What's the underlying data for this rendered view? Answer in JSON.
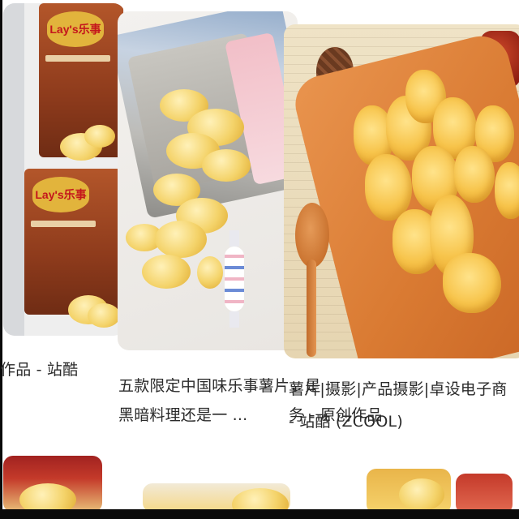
{
  "results": [
    {
      "caption": "作品 - 站酷",
      "image": {
        "brand_logo": "Lay's乐事",
        "subject": "chips-bag-icon"
      }
    },
    {
      "caption_line1": "五款限定中国味乐事薯片，是",
      "caption_line2": "黑暗料理还是一 ..."
    },
    {
      "caption_line1": "薯片|摄影|产品摄影|卓设电子商务 - 原创作品",
      "caption_line2": "- 站酷 (ZCOOL)"
    }
  ],
  "colors": {
    "caption_text": "#2a2a2a",
    "card_radius_hint": "rounded",
    "chip_yellow": "#f4d36a",
    "bag_brown": "#8e3b1c",
    "lays_red": "#c4161c",
    "board_orange": "#d97a32"
  }
}
